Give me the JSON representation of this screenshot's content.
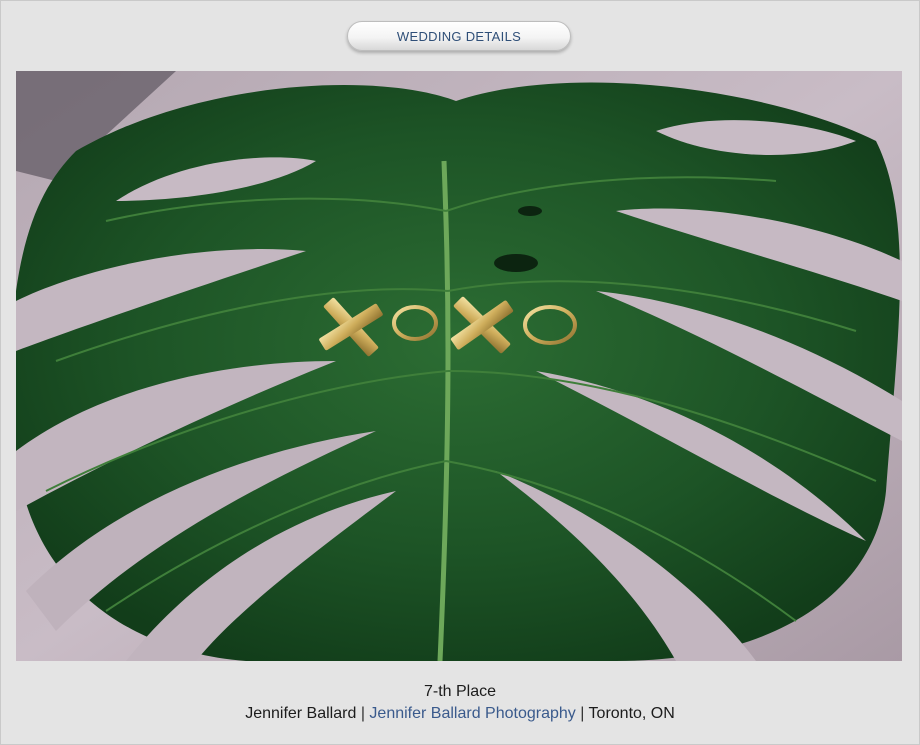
{
  "header": {
    "button_label": "WEDDING DETAILS"
  },
  "photo": {
    "subject": "leaf-rings-image"
  },
  "caption": {
    "title": "7-th Place",
    "photographer": "Jennifer Ballard",
    "separator": "|",
    "studio_link": "Jennifer Ballard Photography",
    "location": "Toronto, ON"
  },
  "colors": {
    "button_text": "#2f4f78",
    "link": "#3a5a8c",
    "leaf": "#1f5a2a",
    "background": "#e4e4e4"
  }
}
